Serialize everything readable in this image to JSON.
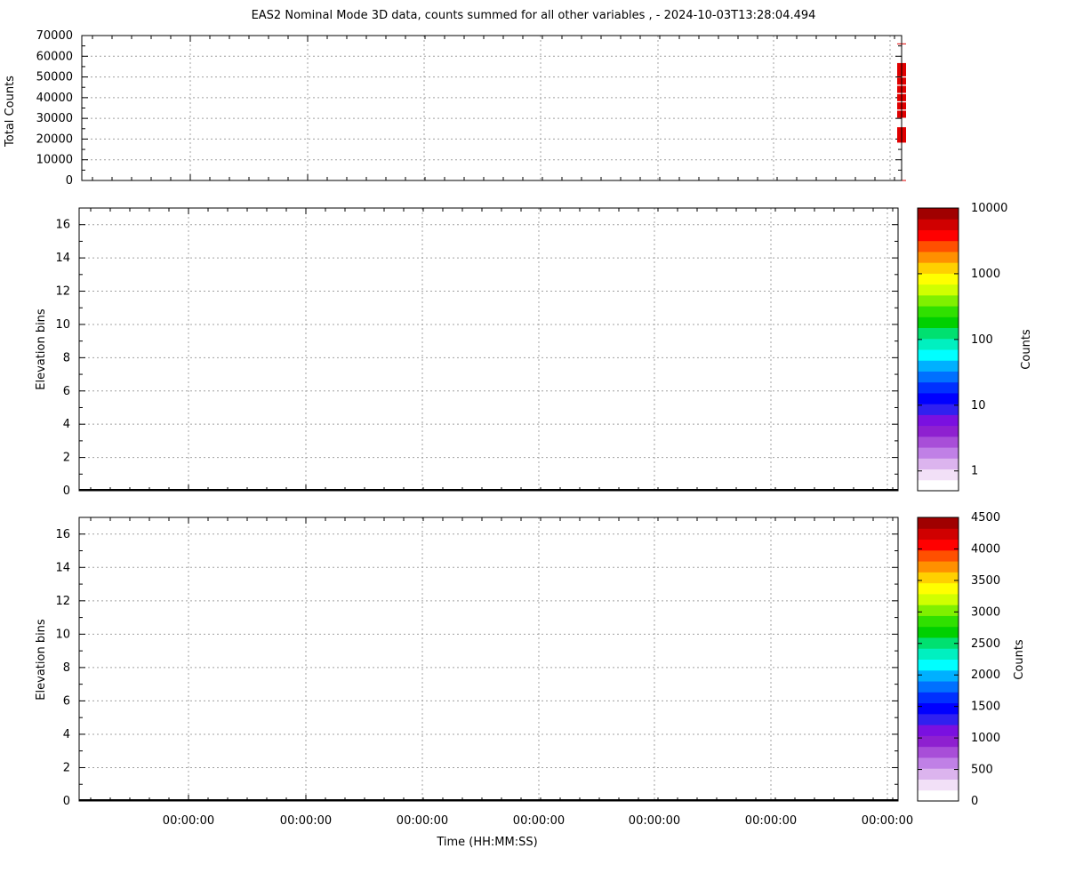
{
  "title": "EAS2  Nominal Mode 3D data, counts summed for all other variables ,   - 2024-10-03T13:28:04.494",
  "chart_data": [
    {
      "type": "line",
      "ylabel": "Total Counts",
      "ylim": [
        0,
        70000
      ],
      "yticks": [
        0,
        10000,
        20000,
        30000,
        40000,
        50000,
        60000,
        70000
      ],
      "grid": true,
      "series": [
        {
          "color": "#e00000",
          "points": [
            {
              "x_frac": 1.0,
              "y": 0
            },
            {
              "x_frac": 1.0,
              "y": 20000
            },
            {
              "x_frac": 1.0,
              "y": 21000
            },
            {
              "x_frac": 1.0,
              "y": 22000
            },
            {
              "x_frac": 1.0,
              "y": 23000
            },
            {
              "x_frac": 1.0,
              "y": 24000
            },
            {
              "x_frac": 1.0,
              "y": 32000
            },
            {
              "x_frac": 1.0,
              "y": 36000
            },
            {
              "x_frac": 1.0,
              "y": 40000
            },
            {
              "x_frac": 1.0,
              "y": 44000
            },
            {
              "x_frac": 1.0,
              "y": 48000
            },
            {
              "x_frac": 1.0,
              "y": 52000
            },
            {
              "x_frac": 1.0,
              "y": 55000
            },
            {
              "x_frac": 1.0,
              "y": 66000
            }
          ]
        }
      ]
    },
    {
      "type": "heatmap",
      "ylabel": "Elevation bins",
      "ylim": [
        0,
        17
      ],
      "yticks": [
        0,
        2,
        4,
        6,
        8,
        10,
        12,
        14,
        16
      ],
      "grid": true,
      "colorbar": {
        "label": "Counts",
        "scale": "log",
        "range": [
          0.5,
          10000
        ],
        "ticks": [
          1,
          10,
          100,
          1000,
          10000
        ],
        "tick_labels": [
          "1",
          "10",
          "100",
          "1000",
          "10000"
        ]
      }
    },
    {
      "type": "heatmap",
      "ylabel": "Elevation bins",
      "xlabel": "Time (HH:MM:SS)",
      "ylim": [
        0,
        17
      ],
      "yticks": [
        0,
        2,
        4,
        6,
        8,
        10,
        12,
        14,
        16
      ],
      "xtick_labels": [
        "00:00:00",
        "00:00:00",
        "00:00:00",
        "00:00:00",
        "00:00:00",
        "00:00:00",
        "00:00:00"
      ],
      "grid": true,
      "colorbar": {
        "label": "Counts",
        "scale": "linear",
        "range": [
          0,
          4500
        ],
        "ticks": [
          0,
          500,
          1000,
          1500,
          2000,
          2500,
          3000,
          3500,
          4000,
          4500
        ],
        "tick_labels": [
          "0",
          "500",
          "1000",
          "1500",
          "2000",
          "2500",
          "3000",
          "3500",
          "4000",
          "4500"
        ]
      }
    }
  ],
  "colormap": [
    "#ffffff",
    "#f2e0f7",
    "#dcb4ee",
    "#c080e6",
    "#a84ed8",
    "#8e20d0",
    "#7a10e0",
    "#3020f0",
    "#0000ff",
    "#0030ff",
    "#0070ff",
    "#00b0ff",
    "#00ffff",
    "#00f0c0",
    "#00e070",
    "#00d000",
    "#30e000",
    "#80f000",
    "#d0ff00",
    "#ffff00",
    "#ffd000",
    "#ff9000",
    "#ff5000",
    "#ff0000",
    "#d00000",
    "#a00000"
  ]
}
